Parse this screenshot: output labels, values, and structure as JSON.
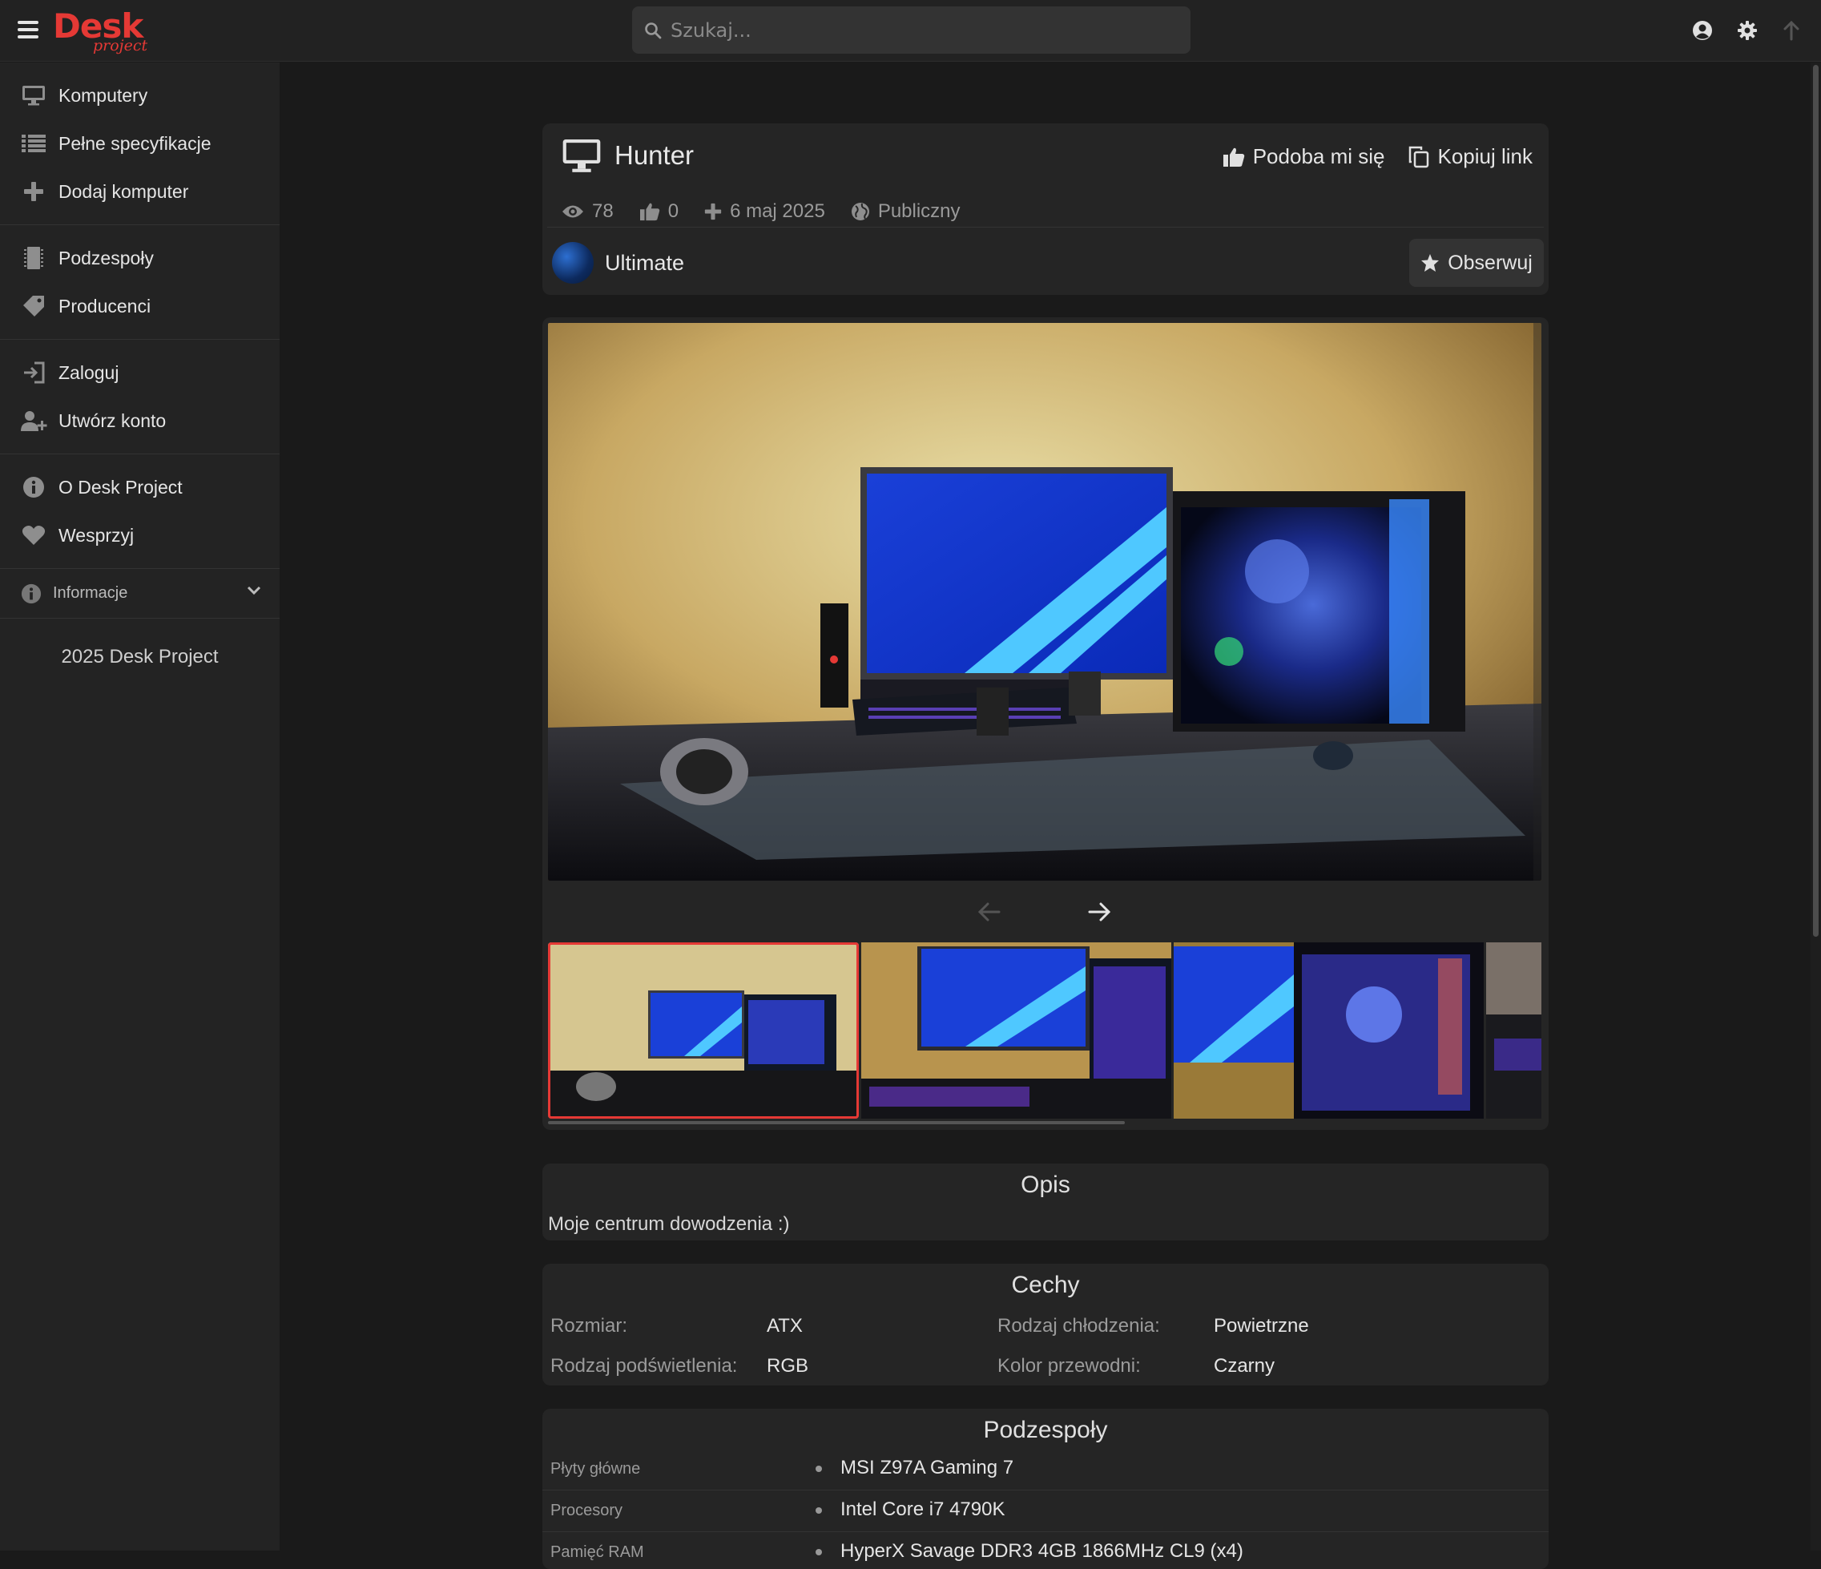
{
  "topbar": {
    "logo_main": "Desk",
    "logo_sub": "project",
    "search_placeholder": "Szukaj..."
  },
  "sidebar": {
    "groups": [
      [
        {
          "label": "Komputery",
          "icon": "monitor-icon"
        },
        {
          "label": "Pełne specyfikacje",
          "icon": "list-icon"
        },
        {
          "label": "Dodaj komputer",
          "icon": "plus-icon"
        }
      ],
      [
        {
          "label": "Podzespoły",
          "icon": "memory-chip-icon"
        },
        {
          "label": "Producenci",
          "icon": "tag-icon"
        }
      ],
      [
        {
          "label": "Zaloguj",
          "icon": "sign-in-icon"
        },
        {
          "label": "Utwórz konto",
          "icon": "user-plus-icon"
        }
      ],
      [
        {
          "label": "O Desk Project",
          "icon": "info-icon"
        },
        {
          "label": "Wesprzyj",
          "icon": "heart-icon"
        }
      ]
    ],
    "info_label": "Informacje",
    "copyright": "2025 Desk Project"
  },
  "computer": {
    "title": "Hunter",
    "like_label": "Podoba mi się",
    "copy_label": "Kopiuj link",
    "views": "78",
    "likes": "0",
    "added": "6 maj 2025",
    "visibility": "Publiczny",
    "owner": "Ultimate",
    "follow_label": "Obserwuj"
  },
  "description": {
    "title": "Opis",
    "text": "Moje centrum dowodzenia :)"
  },
  "features": {
    "title": "Cechy",
    "size_label": "Rozmiar:",
    "size_value": "ATX",
    "cooling_label": "Rodzaj chłodzenia:",
    "cooling_value": "Powietrzne",
    "lighting_label": "Rodzaj podświetlenia:",
    "lighting_value": "RGB",
    "color_label": "Kolor przewodni:",
    "color_value": "Czarny"
  },
  "components": {
    "title": "Podzespoły",
    "rows": [
      {
        "category": "Płyty główne",
        "value": "MSI Z97A Gaming 7"
      },
      {
        "category": "Procesory",
        "value": "Intel Core i7 4790K"
      },
      {
        "category": "Pamięć RAM",
        "value": "HyperX Savage DDR3 4GB 1866MHz CL9 (x4)"
      }
    ]
  },
  "colors": {
    "accent": "#e53935",
    "background": "#1a1a1a",
    "card": "#252525"
  }
}
